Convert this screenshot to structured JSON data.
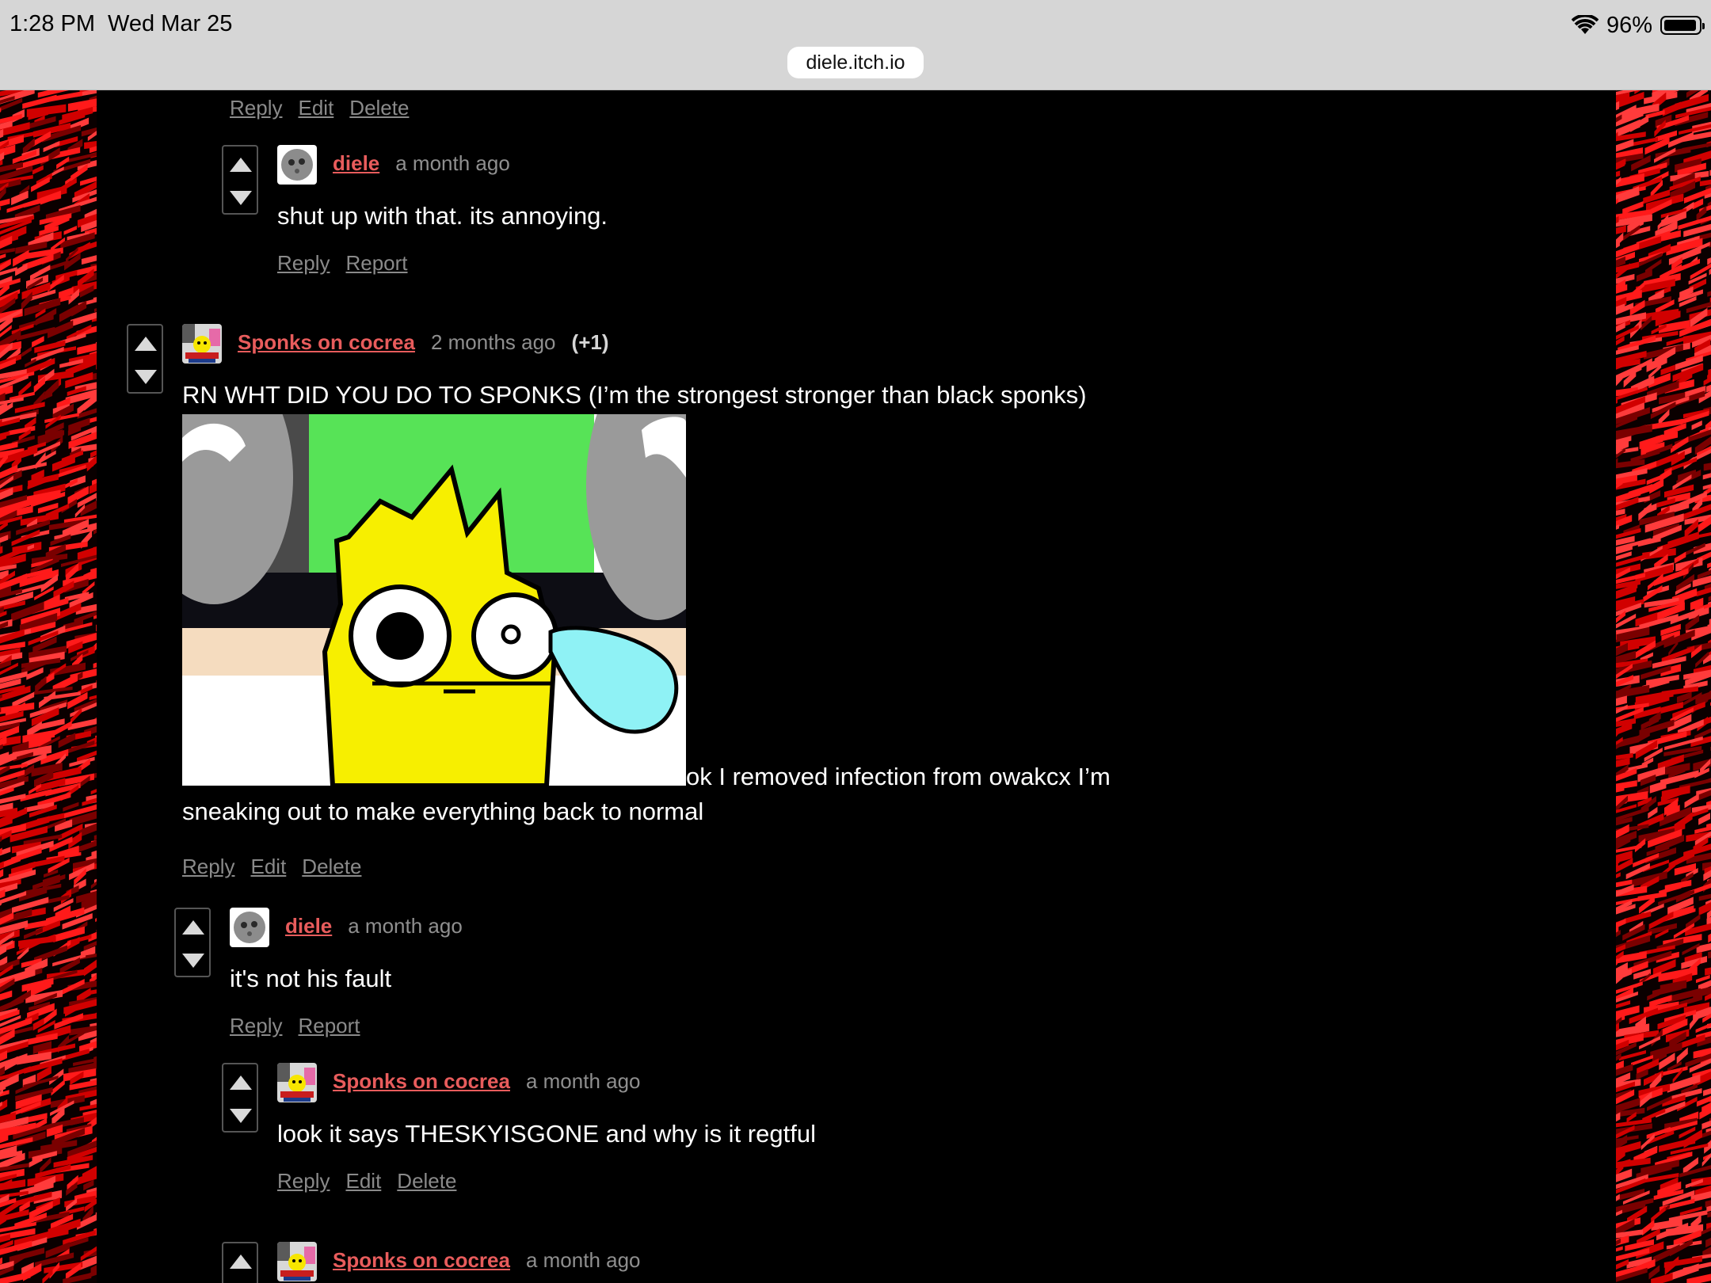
{
  "status_bar": {
    "time": "1:28 PM",
    "date": "Wed Mar 25",
    "battery": "96%",
    "battery_level": 0.96,
    "url": "diele.itch.io",
    "icons": [
      "wifi-icon",
      "battery-icon"
    ]
  },
  "colors": {
    "background": "#000000",
    "author_link": "#e85c5c",
    "timestamp": "#8f8f8f",
    "action_link": "#8a8a8a",
    "side_pattern": "#ff1a1a"
  },
  "thread": {
    "top_actions": {
      "reply": "Reply",
      "edit": "Edit",
      "delete": "Delete"
    },
    "comment1": {
      "author": "diele",
      "time": "a month ago",
      "body": "shut up with that. its annoying.",
      "actions": {
        "reply": "Reply",
        "report": "Report"
      }
    },
    "comment2": {
      "author": "Sponks on cocrea",
      "time": "2 months ago",
      "score": "(+1)",
      "body_line1": "RN WHT DID YOU DO TO SPONKS (I’m the strongest stronger than black sponks)",
      "body_after_image": "ok I removed infection from owakcx I’m",
      "body_last": "sneaking out to make everything back to normal",
      "actions": {
        "reply": "Reply",
        "edit": "Edit",
        "delete": "Delete"
      }
    },
    "comment3": {
      "author": "diele",
      "time": "a month ago",
      "body": "it's not his fault",
      "actions": {
        "reply": "Reply",
        "report": "Report"
      }
    },
    "comment4": {
      "author": "Sponks on cocrea",
      "time": "a month ago",
      "body": "look it says THESKYISGONE and why is it regtful",
      "actions": {
        "reply": "Reply",
        "edit": "Edit",
        "delete": "Delete"
      }
    },
    "comment5": {
      "author": "Sponks on cocrea",
      "time": "a month ago"
    }
  }
}
